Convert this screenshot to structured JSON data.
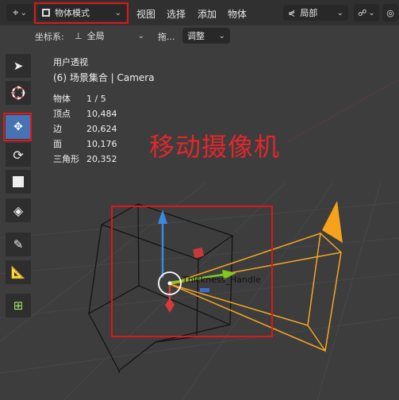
{
  "header": {
    "mode_select": {
      "label": "物体模式"
    },
    "menu": [
      "视图",
      "选择",
      "添加",
      "物体"
    ],
    "orientation": {
      "label": "局部"
    }
  },
  "toolbar2": {
    "coord_label": "坐标系:",
    "coord_value": "全局",
    "drag_label": "拖...",
    "adjust_label": "调整"
  },
  "overlay": {
    "view_name": "用户透视",
    "collection": "(6) 场景集合 | Camera",
    "stats": [
      {
        "label": "物体",
        "value": "1 / 5"
      },
      {
        "label": "顶点",
        "value": "10,484"
      },
      {
        "label": "边",
        "value": "20,624"
      },
      {
        "label": "面",
        "value": "10,176"
      },
      {
        "label": "三角形",
        "value": "20,352"
      }
    ]
  },
  "annotation": "移动摄像机",
  "viewport": {
    "object_label": "Thickness_Handle"
  },
  "tools": [
    "select-tool",
    "cursor-tool",
    "move-tool",
    "rotate-tool",
    "scale-tool",
    "transform-tool",
    "annotate-tool",
    "measure-tool",
    "add-cube-tool"
  ],
  "colors": {
    "annotation_red": "#e3262c",
    "active_tool": "#4772b3",
    "camera_orange": "#f5a623",
    "axis_x": "#e23a3a",
    "axis_y": "#7ecb1e",
    "axis_z": "#3a8ae0"
  }
}
